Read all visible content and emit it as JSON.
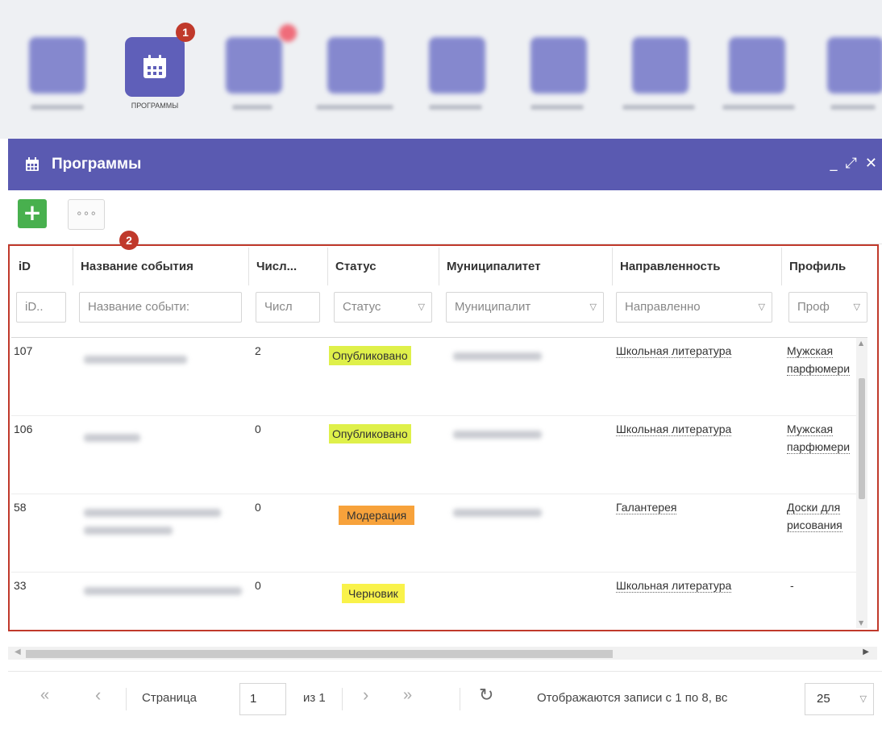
{
  "launcher": {
    "selected_label": "ПРОГРАММЫ",
    "badge1": "1"
  },
  "window": {
    "title": "Программы",
    "controls": {
      "minimize": "_",
      "maximize": "⤢",
      "close": "✕"
    }
  },
  "toolbar": {
    "add_label": "+",
    "more_label": "∘∘∘"
  },
  "grid": {
    "badge2": "2",
    "columns": [
      {
        "header": "iD",
        "filter": "iD.."
      },
      {
        "header": "Название события",
        "filter": "Название событи:"
      },
      {
        "header": "Числ...",
        "filter": "Числ"
      },
      {
        "header": "Статус",
        "filter": "Статус"
      },
      {
        "header": "Муниципалитет",
        "filter": "Муниципалит"
      },
      {
        "header": "Направленность",
        "filter": "Направленно"
      },
      {
        "header": "Профиль",
        "filter": "Проф"
      }
    ],
    "rows": [
      {
        "id": "107",
        "count": "2",
        "status": "Опубликовано",
        "status_color": "#dff04a",
        "direction": "Школьная литература",
        "profile_1": "Мужская",
        "profile_2": "парфюмери"
      },
      {
        "id": "106",
        "count": "0",
        "status": "Опубликовано",
        "status_color": "#dff04a",
        "direction": "Школьная литература",
        "profile_1": "Мужская",
        "profile_2": "парфюмери"
      },
      {
        "id": "58",
        "count": "0",
        "status": "Модерация",
        "status_color": "#f7a23b",
        "direction": "Галантерея",
        "profile_1": "Доски для",
        "profile_2": "рисования"
      },
      {
        "id": "33",
        "count": "0",
        "status": "Черновик",
        "status_color": "#f9f24a",
        "direction": "Школьная литература",
        "profile_1": "-",
        "profile_2": ""
      }
    ]
  },
  "pager": {
    "first": "«",
    "prev": "‹",
    "page_label": "Страница",
    "page_value": "1",
    "of_label": "из 1",
    "next": "›",
    "last": "»",
    "refresh": "↻",
    "records_text": "Отображаются записи с 1 по 8, вс",
    "page_size": "25"
  }
}
